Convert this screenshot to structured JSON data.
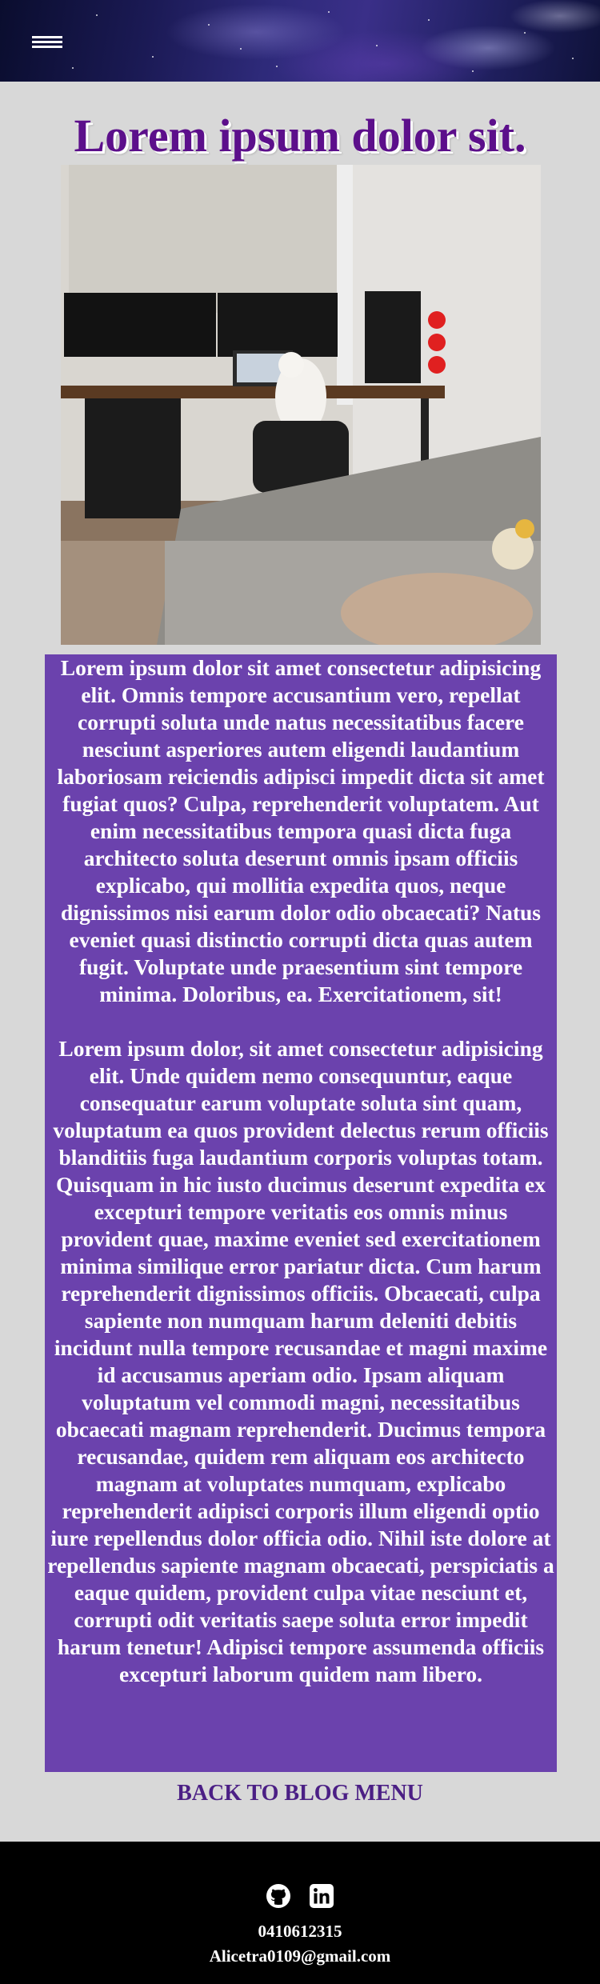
{
  "header": {
    "menu_icon": "hamburger-menu-icon"
  },
  "page": {
    "title": "Lorem ipsum dolor sit."
  },
  "photo": {
    "alt": "Home office desk with three monitors, a laptop, a gaming PC tower and a white cat on the chair, next to a grey sofa with a blanket"
  },
  "article": {
    "paragraphs": [
      "Lorem ipsum dolor sit amet consectetur adipisicing elit. Omnis tempore accusantium vero, repellat corrupti soluta unde natus necessitatibus facere nesciunt asperiores autem eligendi laudantium laboriosam reiciendis adipisci impedit dicta sit amet fugiat quos? Culpa, reprehenderit voluptatem. Aut enim necessitatibus tempora quasi dicta fuga architecto soluta deserunt omnis ipsam officiis explicabo, qui mollitia expedita quos, neque dignissimos nisi earum dolor odio obcaecati? Natus eveniet quasi distinctio corrupti dicta quas autem fugit. Voluptate unde praesentium sint tempore minima. Doloribus, ea. Exercitationem, sit!",
      "Lorem ipsum dolor, sit amet consectetur adipisicing elit. Unde quidem nemo consequuntur, eaque consequatur earum voluptate soluta sint quam, voluptatum ea quos provident delectus rerum officiis blanditiis fuga laudantium corporis voluptas totam. Quisquam in hic iusto ducimus deserunt expedita ex excepturi tempore veritatis eos omnis minus provident quae, maxime eveniet sed exercitationem minima similique error pariatur dicta. Cum harum reprehenderit dignissimos officiis. Obcaecati, culpa sapiente non numquam harum deleniti debitis incidunt nulla tempore recusandae et magni maxime id accusamus aperiam odio. Ipsam aliquam voluptatum vel commodi magni, necessitatibus obcaecati magnam reprehenderit. Ducimus tempora recusandae, quidem rem aliquam eos architecto magnam at voluptates numquam, explicabo reprehenderit adipisci corporis illum eligendi optio iure repellendus dolor officia odio. Nihil iste dolore at repellendus sapiente magnam obcaecati, perspiciatis a eaque quidem, provident culpa vitae nesciunt et, corrupti odit veritatis saepe soluta error impedit harum tenetur! Adipisci tempore assumenda officiis excepturi laborum quidem nam libero."
    ]
  },
  "nav": {
    "back_label": "BACK TO BLOG MENU"
  },
  "footer": {
    "icons": [
      "github-icon",
      "linkedin-icon"
    ],
    "phone": "0410612315",
    "email": "Alicetra0109@gmail.com"
  },
  "colors": {
    "title": "#5c0f8b",
    "article_bg": "#6b42ad",
    "page_bg": "#d8d8d8",
    "back_link": "#4b1f85",
    "footer_bg": "#000000"
  }
}
